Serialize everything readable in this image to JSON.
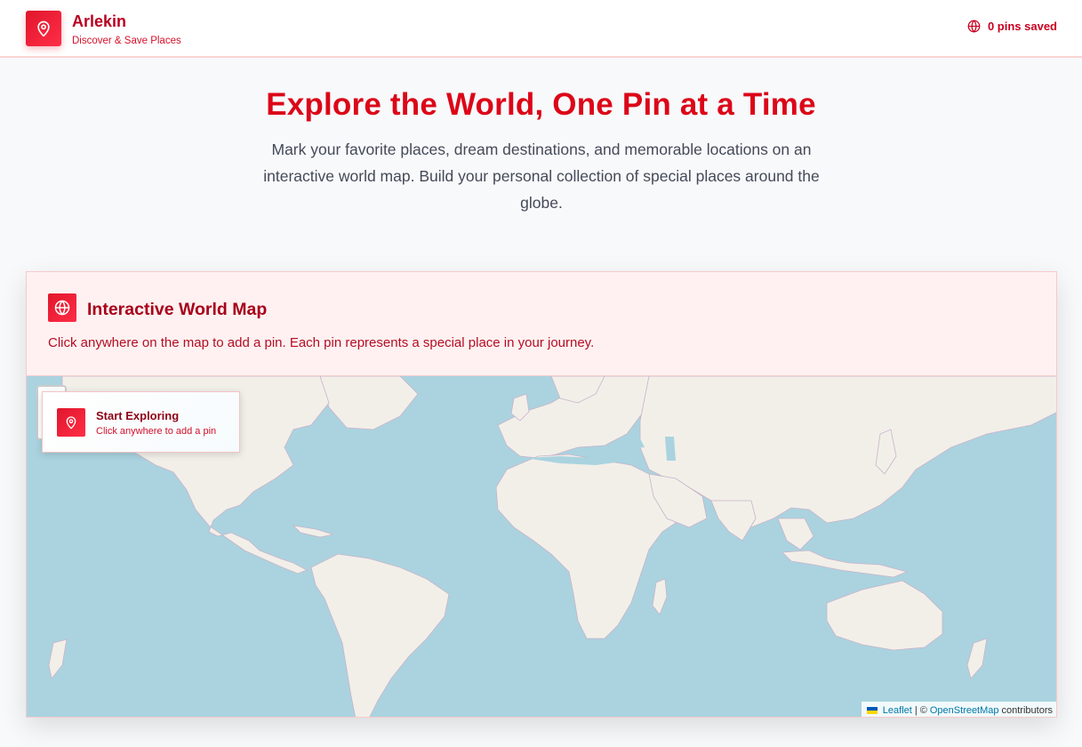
{
  "header": {
    "brand_name": "Arlekin",
    "tagline": "Discover & Save Places",
    "pins_saved": "0 pins saved"
  },
  "hero": {
    "title": "Explore the World, One Pin at a Time",
    "subtitle": "Mark your favorite places, dream destinations, and memorable locations on an interactive world map. Build your personal collection of special places around the globe."
  },
  "map_card": {
    "title": "Interactive World Map",
    "description": "Click anywhere on the map to add a pin. Each pin represents a special place in your journey."
  },
  "explore_popup": {
    "title": "Start Exploring",
    "subtitle": "Click anywhere to add a pin"
  },
  "attribution": {
    "leaflet": "Leaflet",
    "separator": "| ©",
    "osm": "OpenStreetMap",
    "suffix": "contributors"
  },
  "colors": {
    "accent": "#e0162b",
    "accent_dark": "#b8001f",
    "ocean": "#aad3df",
    "land": "#f2efe9"
  }
}
